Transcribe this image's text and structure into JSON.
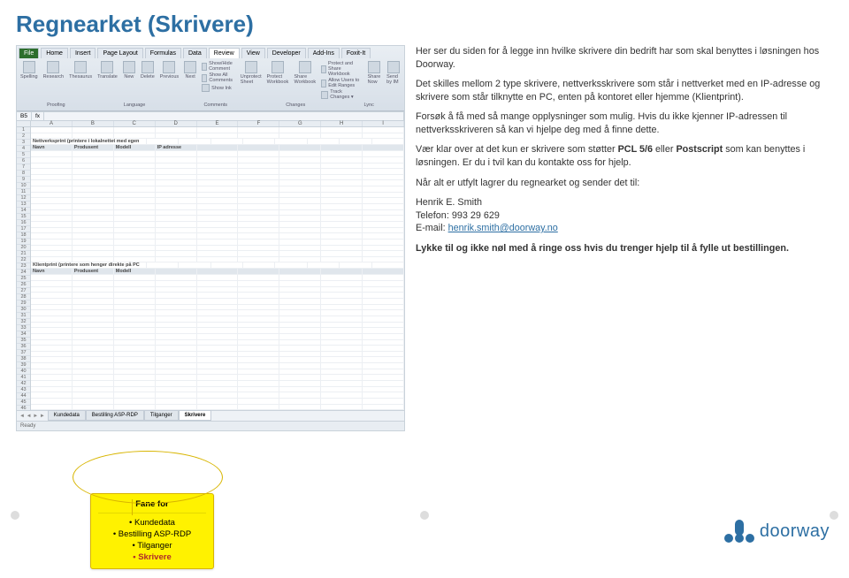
{
  "title": "Regnearket (Skrivere)",
  "spreadsheet": {
    "ribbon_tabs": [
      "File",
      "Home",
      "Insert",
      "Page Layout",
      "Formulas",
      "Data",
      "Review",
      "View",
      "Developer",
      "Add-Ins",
      "Foxit-It"
    ],
    "active_tab": "Review",
    "groups": {
      "g1": "Spelling",
      "g2": "Research",
      "g3": "Thesaurus",
      "g4": "Translate",
      "g5": "New",
      "g6": "Delete",
      "g7": "Previous",
      "g8": "Next",
      "c1": "Show/Hide Comment",
      "c2": "Show All Comments",
      "c3": "Show Ink",
      "g9": "Unprotect Sheet",
      "g10": "Protect Workbook",
      "g11": "Share Workbook",
      "c4": "Protect and Share Workbook",
      "c5": "Allow Users to Edit Ranges",
      "c6": "Track Changes ▾",
      "g12": "Share Now",
      "g13": "Send by IM",
      "sec1": "Proofing",
      "sec2": "Language",
      "sec3": "Comments",
      "sec4": "Changes",
      "sec5": "Lync"
    },
    "cell_ref": "B5",
    "fx": "fx",
    "columns": [
      "A",
      "B",
      "C",
      "D",
      "E",
      "F",
      "G",
      "H",
      "I"
    ],
    "section1": "Nettverksprint (printere i lokalnettet med egen IP-adresse)",
    "headers1": [
      "Navn",
      "Produsent",
      "Modell",
      "IP adresse"
    ],
    "section2": "Klientprint (printere som henger direkte på PC arbeidsstasjon)",
    "headers2": [
      "Navn",
      "Produsent",
      "Modell"
    ],
    "sheet_tabs": [
      "Kundedata",
      "Bestilling ASP-RDP",
      "Tilganger",
      "Skrivere"
    ],
    "active_sheet": "Skrivere",
    "sheet_nav": "◄ ◄ ► ►",
    "status": "Ready"
  },
  "explain": {
    "p1": "Her ser du siden for å legge inn hvilke skrivere din bedrift har som skal benyttes i løsningen hos Doorway.",
    "p2": "Det skilles mellom 2 type skrivere, nettverksskrivere som står i nettverket med en IP-adresse og skrivere som står tilknytte en PC, enten på kontoret eller hjemme (Klientprint).",
    "p3": "Forsøk å få med så mange opplysninger som mulig. Hvis du ikke kjenner IP-adressen til nettverksskriveren så kan vi hjelpe deg med å finne dette.",
    "p4a": "Vær klar over at det kun er skrivere som støtter ",
    "p4b": "PCL 5/6",
    "p4c": " eller ",
    "p4d": "Postscript",
    "p4e": " som kan benyttes i løsningen. Er du i tvil kan du kontakte oss for hjelp.",
    "p5": "Når alt er utfylt lagrer du regnearket og sender det til:",
    "contact_name": "Henrik E. Smith",
    "contact_tel": "Telefon: 993 29 629",
    "contact_email_label": "E-mail: ",
    "contact_email": "henrik.smith@doorway.no",
    "p6": "Lykke til og ikke nøl med å ringe oss hvis du trenger hjelp til å fylle ut bestillingen."
  },
  "callout": {
    "title": "Fane for",
    "items": [
      "Kundedata",
      "Bestilling ASP-RDP",
      "Tilganger",
      "Skrivere"
    ],
    "current_index": 3
  },
  "logo_text": "doorway"
}
